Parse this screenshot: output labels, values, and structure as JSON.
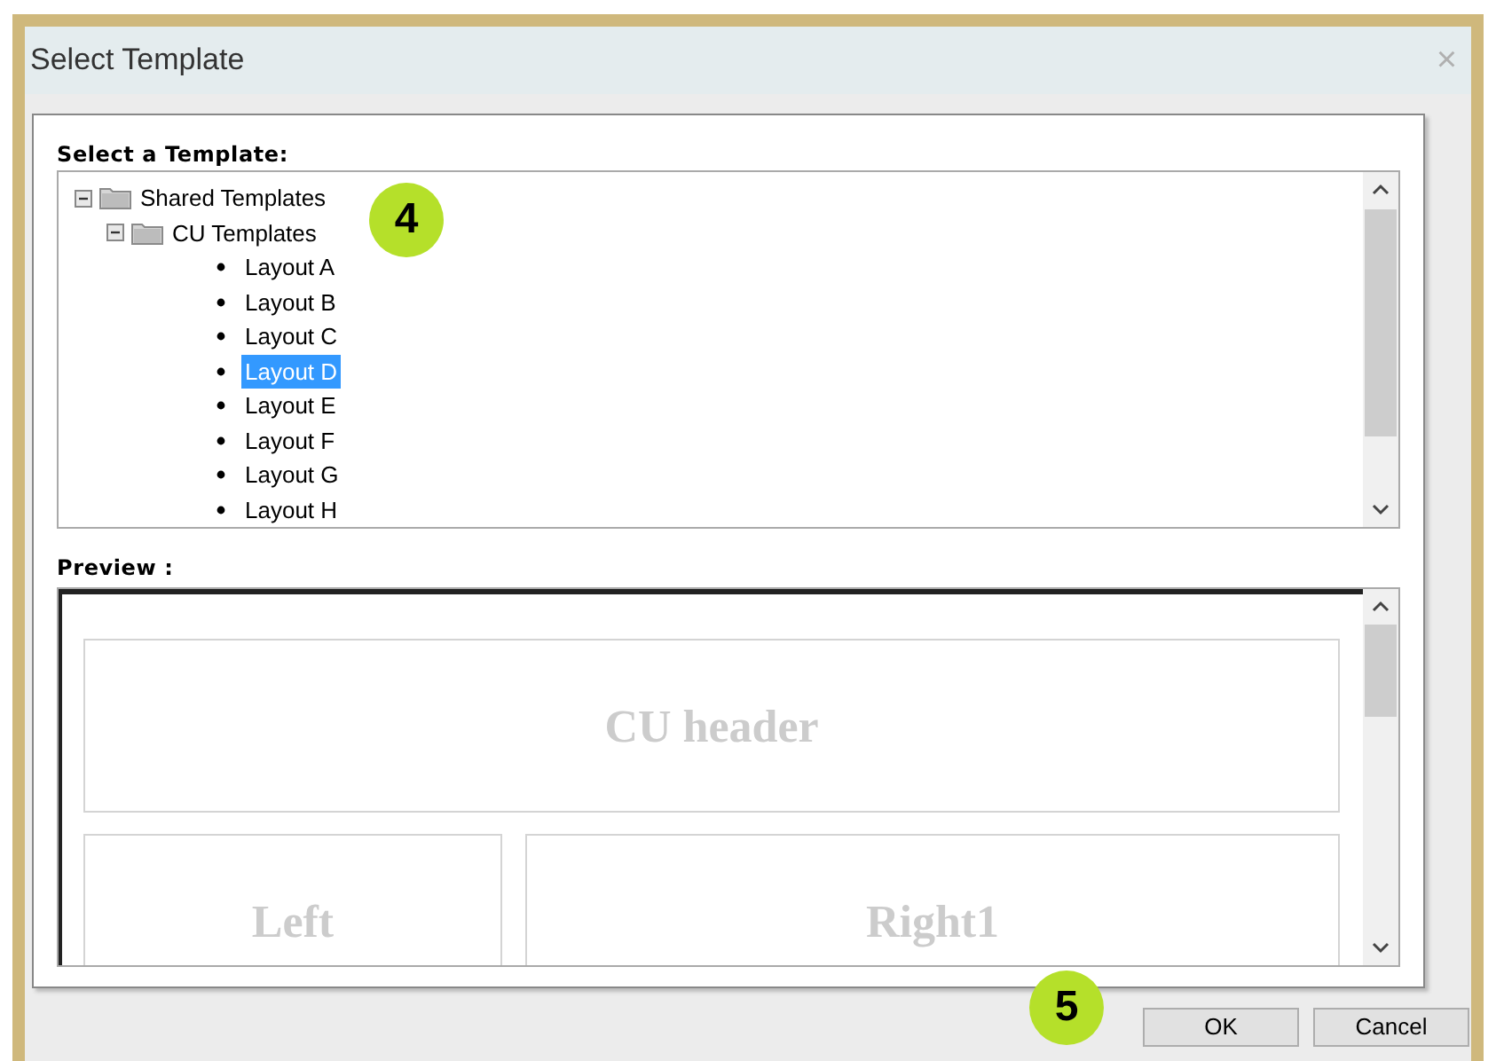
{
  "window": {
    "title": "Select Template",
    "close": "×"
  },
  "tree": {
    "label": "Select a Template:",
    "items": [
      {
        "kind": "folder",
        "label": "Shared Templates",
        "expanded": true,
        "children": [
          {
            "kind": "folder",
            "label": "CU Templates",
            "expanded": true,
            "children": [
              {
                "kind": "leaf",
                "label": "Layout A",
                "selected": false
              },
              {
                "kind": "leaf",
                "label": "Layout B",
                "selected": false
              },
              {
                "kind": "leaf",
                "label": "Layout C",
                "selected": false
              },
              {
                "kind": "leaf",
                "label": "Layout D",
                "selected": true
              },
              {
                "kind": "leaf",
                "label": "Layout E",
                "selected": false
              },
              {
                "kind": "leaf",
                "label": "Layout F",
                "selected": false
              },
              {
                "kind": "leaf",
                "label": "Layout G",
                "selected": false
              },
              {
                "kind": "leaf",
                "label": "Layout H",
                "selected": false
              }
            ]
          }
        ]
      }
    ]
  },
  "preview": {
    "label": "Preview :",
    "header": "CU header",
    "left": "Left",
    "right": "Right1"
  },
  "buttons": [
    "OK",
    "Cancel"
  ],
  "callouts": [
    "4",
    "5"
  ]
}
